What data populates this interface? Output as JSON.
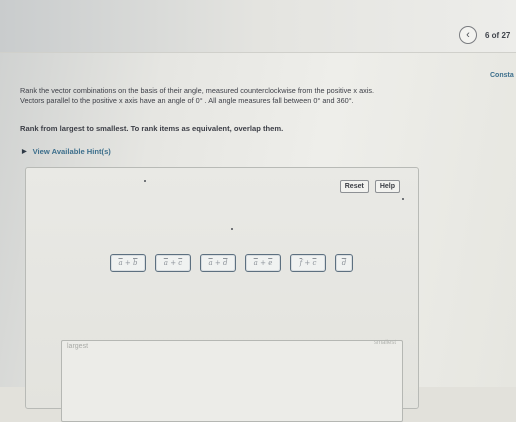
{
  "header": {
    "prev_icon": "chevron-left-icon",
    "prev_glyph": "‹",
    "page_count": "6 of 27"
  },
  "constants_link": "Consta",
  "instructions": {
    "line1": "Rank the vector combinations on the basis of their angle, measured counterclockwise from the positive x axis.",
    "line2": "Vectors parallel to the positive x axis have an angle of 0° . All angle measures fall between 0° and 360°.",
    "rank_instruction": "Rank from largest to smallest. To rank items as equivalent, overlap them."
  },
  "hints": {
    "caret": "▶",
    "label": "View Available Hint(s)"
  },
  "panel": {
    "reset_label": "Reset",
    "help_label": "Help",
    "tiles": [
      {
        "a": "a",
        "op": "+",
        "b": "b"
      },
      {
        "a": "a",
        "op": "+",
        "b": "c"
      },
      {
        "a": "a",
        "op": "+",
        "b": "d"
      },
      {
        "a": "a",
        "op": "+",
        "b": "e"
      },
      {
        "a": "f",
        "op": "+",
        "b": "c"
      },
      {
        "a": "d",
        "op": "",
        "b": ""
      }
    ],
    "largest_label": "largest",
    "smallest_label": "smallest"
  }
}
